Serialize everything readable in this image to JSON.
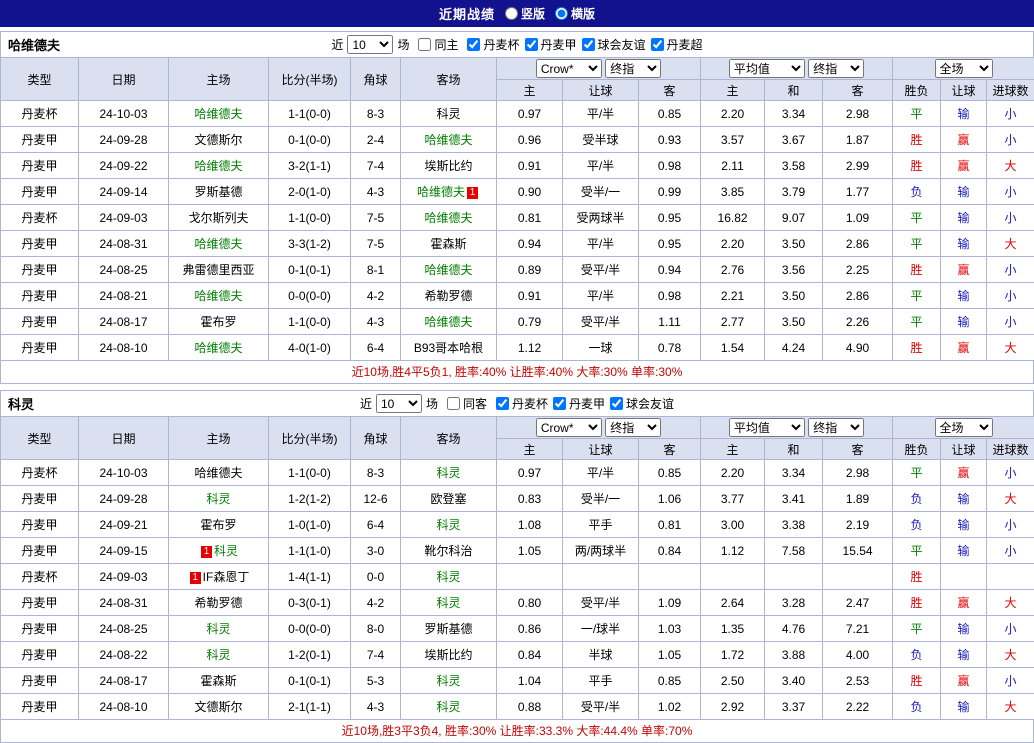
{
  "title_bar": {
    "title": "近期战绩",
    "vertical": "竖版",
    "vertical_selected": false,
    "horizontal": "横版",
    "horizontal_selected": true
  },
  "labels": {
    "near": "近",
    "games": "场"
  },
  "dropdowns": {
    "bookmaker": "Crow*",
    "stage": "终指",
    "average": "平均值",
    "scope": "全场"
  },
  "columns": {
    "type": "类型",
    "date": "日期",
    "home": "主场",
    "score": "比分(半场)",
    "corners": "角球",
    "away": "客场",
    "odds_home": "主",
    "odds_handicap": "让球",
    "odds_away": "客",
    "avg_home": "主",
    "avg_draw": "和",
    "avg_away": "客",
    "result": "胜负",
    "handicap_result": "让球",
    "goals": "进球数"
  },
  "colors": {
    "red": "#e60000",
    "green": "#008000",
    "blue": "#1717c4",
    "focus_team": "#008000",
    "score": "#e60000",
    "league_bg": "#8286cb",
    "header_bg": "#dbe0f1",
    "title_bg": "#12128e"
  },
  "result_color_map": {
    "胜": "red",
    "平": "green",
    "负": "blue",
    "赢": "red",
    "输": "blue",
    "大": "red",
    "小": "blue"
  },
  "sections": [
    {
      "team": "哈维德夫",
      "filter": {
        "count": "10",
        "same_label": "同主",
        "same_checked": false,
        "leagues": [
          {
            "label": "丹麦杯",
            "checked": true
          },
          {
            "label": "丹麦甲",
            "checked": true
          },
          {
            "label": "球会友谊",
            "checked": true
          },
          {
            "label": "丹麦超",
            "checked": true
          }
        ]
      },
      "rows": [
        {
          "league": "丹麦杯",
          "date": "24-10-03",
          "home": "哈维德夫",
          "hf": true,
          "score": "1-1(0-0)",
          "corners": "8-3",
          "away": "科灵",
          "o1": "0.97",
          "h": "平/半",
          "o2": "0.85",
          "a1": "2.20",
          "a2": "3.34",
          "a3": "2.98",
          "r": "平",
          "hr": "输",
          "g": "小"
        },
        {
          "league": "丹麦甲",
          "date": "24-09-28",
          "home": "文德斯尔",
          "score": "0-1(0-0)",
          "corners": "2-4",
          "away": "哈维德夫",
          "af": true,
          "o1": "0.96",
          "h": "受半球",
          "o2": "0.93",
          "a1": "3.57",
          "a2": "3.67",
          "a3": "1.87",
          "r": "胜",
          "hr": "赢",
          "g": "小"
        },
        {
          "league": "丹麦甲",
          "date": "24-09-22",
          "home": "哈维德夫",
          "hf": true,
          "score": "3-2(1-1)",
          "corners": "7-4",
          "away": "埃斯比约",
          "o1": "0.91",
          "h": "平/半",
          "o2": "0.98",
          "a1": "2.11",
          "a2": "3.58",
          "a3": "2.99",
          "r": "胜",
          "hr": "赢",
          "g": "大"
        },
        {
          "league": "丹麦甲",
          "date": "24-09-14",
          "home": "罗斯基德",
          "score": "2-0(1-0)",
          "corners": "4-3",
          "away": "哈维德夫",
          "af": true,
          "abadge": "1",
          "o1": "0.90",
          "h": "受半/一",
          "o2": "0.99",
          "a1": "3.85",
          "a2": "3.79",
          "a3": "1.77",
          "r": "负",
          "hr": "输",
          "g": "小"
        },
        {
          "league": "丹麦杯",
          "date": "24-09-03",
          "home": "戈尔斯列夫",
          "score": "1-1(0-0)",
          "corners": "7-5",
          "away": "哈维德夫",
          "af": true,
          "o1": "0.81",
          "h": "受两球半",
          "o2": "0.95",
          "a1": "16.82",
          "a2": "9.07",
          "a3": "1.09",
          "r": "平",
          "hr": "输",
          "g": "小"
        },
        {
          "league": "丹麦甲",
          "date": "24-08-31",
          "home": "哈维德夫",
          "hf": true,
          "score": "3-3(1-2)",
          "corners": "7-5",
          "away": "霍森斯",
          "o1": "0.94",
          "h": "平/半",
          "o2": "0.95",
          "a1": "2.20",
          "a2": "3.50",
          "a3": "2.86",
          "r": "平",
          "hr": "输",
          "g": "大"
        },
        {
          "league": "丹麦甲",
          "date": "24-08-25",
          "home": "弗雷德里西亚",
          "score": "0-1(0-1)",
          "corners": "8-1",
          "away": "哈维德夫",
          "af": true,
          "o1": "0.89",
          "h": "受平/半",
          "o2": "0.94",
          "a1": "2.76",
          "a2": "3.56",
          "a3": "2.25",
          "r": "胜",
          "hr": "赢",
          "g": "小"
        },
        {
          "league": "丹麦甲",
          "date": "24-08-21",
          "home": "哈维德夫",
          "hf": true,
          "score": "0-0(0-0)",
          "corners": "4-2",
          "away": "希勒罗德",
          "o1": "0.91",
          "h": "平/半",
          "o2": "0.98",
          "a1": "2.21",
          "a2": "3.50",
          "a3": "2.86",
          "r": "平",
          "hr": "输",
          "g": "小"
        },
        {
          "league": "丹麦甲",
          "date": "24-08-17",
          "home": "霍布罗",
          "score": "1-1(0-0)",
          "corners": "4-3",
          "away": "哈维德夫",
          "af": true,
          "o1": "0.79",
          "h": "受平/半",
          "o2": "1.11",
          "a1": "2.77",
          "a2": "3.50",
          "a3": "2.26",
          "r": "平",
          "hr": "输",
          "g": "小"
        },
        {
          "league": "丹麦甲",
          "date": "24-08-10",
          "home": "哈维德夫",
          "hf": true,
          "score": "4-0(1-0)",
          "corners": "6-4",
          "away": "B93哥本哈根",
          "o1": "1.12",
          "h": "一球",
          "o2": "0.78",
          "a1": "1.54",
          "a2": "4.24",
          "a3": "4.90",
          "r": "胜",
          "hr": "赢",
          "g": "大"
        }
      ],
      "summary": "近10场,胜4平5负1, 胜率:40% 让胜率:40% 大率:30% 单率:30%"
    },
    {
      "team": "科灵",
      "filter": {
        "count": "10",
        "same_label": "同客",
        "same_checked": false,
        "leagues": [
          {
            "label": "丹麦杯",
            "checked": true
          },
          {
            "label": "丹麦甲",
            "checked": true
          },
          {
            "label": "球会友谊",
            "checked": true
          }
        ]
      },
      "rows": [
        {
          "league": "丹麦杯",
          "date": "24-10-03",
          "home": "哈维德夫",
          "score": "1-1(0-0)",
          "corners": "8-3",
          "away": "科灵",
          "af": true,
          "o1": "0.97",
          "h": "平/半",
          "o2": "0.85",
          "a1": "2.20",
          "a2": "3.34",
          "a3": "2.98",
          "r": "平",
          "hr": "赢",
          "g": "小"
        },
        {
          "league": "丹麦甲",
          "date": "24-09-28",
          "home": "科灵",
          "hf": true,
          "score": "1-2(1-2)",
          "corners": "12-6",
          "away": "欧登塞",
          "o1": "0.83",
          "h": "受半/一",
          "o2": "1.06",
          "a1": "3.77",
          "a2": "3.41",
          "a3": "1.89",
          "r": "负",
          "hr": "输",
          "g": "大"
        },
        {
          "league": "丹麦甲",
          "date": "24-09-21",
          "home": "霍布罗",
          "score": "1-0(1-0)",
          "corners": "6-4",
          "away": "科灵",
          "af": true,
          "o1": "1.08",
          "h": "平手",
          "o2": "0.81",
          "a1": "3.00",
          "a2": "3.38",
          "a3": "2.19",
          "r": "负",
          "hr": "输",
          "g": "小"
        },
        {
          "league": "丹麦甲",
          "date": "24-09-15",
          "home": "科灵",
          "hf": true,
          "hbadge": "1",
          "score": "1-1(1-0)",
          "corners": "3-0",
          "away": "靴尔科治",
          "o1": "1.05",
          "h": "两/两球半",
          "o2": "0.84",
          "a1": "1.12",
          "a2": "7.58",
          "a3": "15.54",
          "r": "平",
          "hr": "输",
          "g": "小"
        },
        {
          "league": "丹麦杯",
          "date": "24-09-03",
          "home": "IF森恩丁",
          "hbadge": "1",
          "score": "1-4(1-1)",
          "corners": "0-0",
          "away": "科灵",
          "af": true,
          "o1": "",
          "h": "",
          "o2": "",
          "a1": "",
          "a2": "",
          "a3": "",
          "r": "胜",
          "hr": "",
          "g": ""
        },
        {
          "league": "丹麦甲",
          "date": "24-08-31",
          "home": "希勒罗德",
          "score": "0-3(0-1)",
          "corners": "4-2",
          "away": "科灵",
          "af": true,
          "o1": "0.80",
          "h": "受平/半",
          "o2": "1.09",
          "a1": "2.64",
          "a2": "3.28",
          "a3": "2.47",
          "r": "胜",
          "hr": "赢",
          "g": "大"
        },
        {
          "league": "丹麦甲",
          "date": "24-08-25",
          "home": "科灵",
          "hf": true,
          "score": "0-0(0-0)",
          "corners": "8-0",
          "away": "罗斯基德",
          "o1": "0.86",
          "h": "一/球半",
          "o2": "1.03",
          "a1": "1.35",
          "a2": "4.76",
          "a3": "7.21",
          "r": "平",
          "hr": "输",
          "g": "小"
        },
        {
          "league": "丹麦甲",
          "date": "24-08-22",
          "home": "科灵",
          "hf": true,
          "score": "1-2(0-1)",
          "corners": "7-4",
          "away": "埃斯比约",
          "o1": "0.84",
          "h": "半球",
          "o2": "1.05",
          "a1": "1.72",
          "a2": "3.88",
          "a3": "4.00",
          "r": "负",
          "hr": "输",
          "g": "大"
        },
        {
          "league": "丹麦甲",
          "date": "24-08-17",
          "home": "霍森斯",
          "score": "0-1(0-1)",
          "corners": "5-3",
          "away": "科灵",
          "af": true,
          "o1": "1.04",
          "h": "平手",
          "o2": "0.85",
          "a1": "2.50",
          "a2": "3.40",
          "a3": "2.53",
          "r": "胜",
          "hr": "赢",
          "g": "小"
        },
        {
          "league": "丹麦甲",
          "date": "24-08-10",
          "home": "文德斯尔",
          "score": "2-1(1-1)",
          "corners": "4-3",
          "away": "科灵",
          "af": true,
          "o1": "0.88",
          "h": "受平/半",
          "o2": "1.02",
          "a1": "2.92",
          "a2": "3.37",
          "a3": "2.22",
          "r": "负",
          "hr": "输",
          "g": "大"
        }
      ],
      "summary": "近10场,胜3平3负4, 胜率:30% 让胜率:33.3% 大率:44.4% 单率:70%"
    }
  ]
}
